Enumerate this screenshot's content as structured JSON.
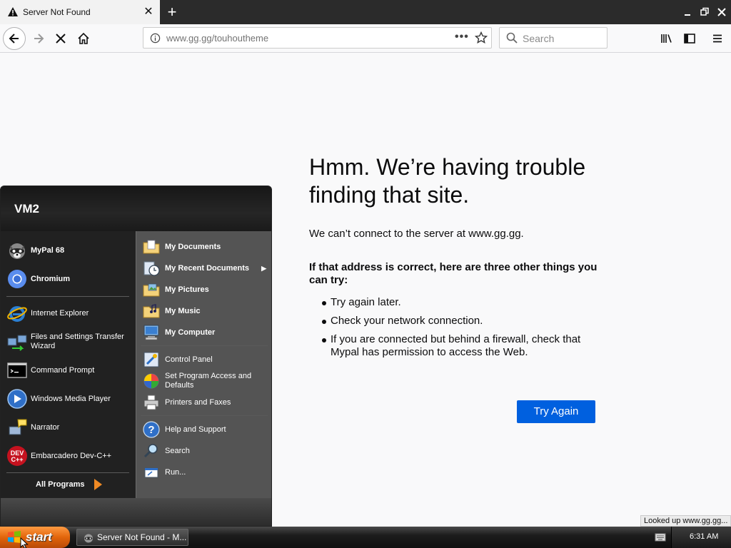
{
  "browser": {
    "tab_title": "Server Not Found",
    "new_tab": "+",
    "url": "www.gg.gg/touhoutheme",
    "search_placeholder": "Search"
  },
  "error_page": {
    "title": "Hmm. We’re having trouble finding that site.",
    "description": "We can’t connect to the server at www.gg.gg.",
    "subtitle": "If that address is correct, here are three other things you can try:",
    "suggestions": [
      "Try again later.",
      "Check your network connection.",
      "If you are connected but behind a firewall, check that Mypal has permission to access the Web."
    ],
    "try_again_label": "Try Again"
  },
  "status_text": "Looked up www.gg.gg...",
  "start_menu": {
    "user": "VM2",
    "pinned": [
      {
        "label": "MyPal 68",
        "icon": "raccoon-icon"
      },
      {
        "label": "Chromium",
        "icon": "chromium-icon"
      }
    ],
    "recent": [
      {
        "label": "Internet Explorer",
        "icon": "ie-icon"
      },
      {
        "label": "Files and Settings Transfer Wizard",
        "icon": "transfer-icon"
      },
      {
        "label": "Command Prompt",
        "icon": "cmd-icon"
      },
      {
        "label": "Windows Media Player",
        "icon": "media-player-icon"
      },
      {
        "label": "Narrator",
        "icon": "narrator-icon"
      },
      {
        "label": "Embarcadero Dev-C++",
        "icon": "devcpp-icon"
      }
    ],
    "all_programs": "All Programs",
    "places": [
      {
        "label": "My Documents",
        "icon": "folder-icon"
      },
      {
        "label": "My Recent Documents",
        "icon": "recent-docs-icon"
      },
      {
        "label": "My Pictures",
        "icon": "pictures-icon"
      },
      {
        "label": "My Music",
        "icon": "music-icon"
      },
      {
        "label": "My Computer",
        "icon": "computer-icon"
      }
    ],
    "settings": [
      {
        "label": "Control Panel",
        "icon": "control-panel-icon"
      },
      {
        "label": "Set Program Access and Defaults",
        "icon": "program-access-icon"
      },
      {
        "label": "Printers and Faxes",
        "icon": "printer-icon"
      }
    ],
    "help": [
      {
        "label": "Help and Support",
        "icon": "help-icon"
      },
      {
        "label": "Search",
        "icon": "search-icon"
      },
      {
        "label": "Run...",
        "icon": "run-icon"
      }
    ]
  },
  "taskbar": {
    "start_label": "start",
    "task_item": "Server Not Found - M...",
    "clock": "6:31 AM"
  },
  "colors": {
    "accent": "#0060df",
    "start_orange": "#e2650b",
    "taskbar": "#1c1c1c"
  }
}
